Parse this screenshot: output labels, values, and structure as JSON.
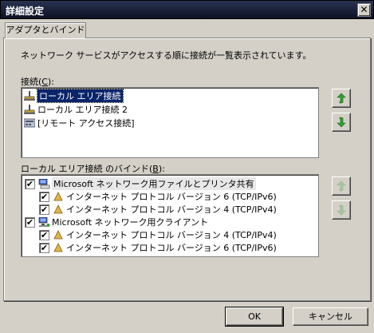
{
  "window": {
    "title": "詳細設定",
    "close_glyph": "✕"
  },
  "tab": {
    "label": "アダプタとバインド"
  },
  "description": "ネットワーク サービスがアクセスする順に接続が一覧表示されています。",
  "connections": {
    "label_prefix": "接続(",
    "label_key": "C",
    "label_suffix": "):",
    "items": [
      {
        "label": "ローカル エリア接続",
        "icon": "network-adapter-icon",
        "selected": true
      },
      {
        "label": "ローカル エリア接続 2",
        "icon": "network-adapter-icon",
        "selected": false
      },
      {
        "label": "[リモート アクセス接続]",
        "icon": "remote-access-icon",
        "selected": false
      }
    ]
  },
  "bindings": {
    "label_prefix": "ローカル エリア接続 のバインド(",
    "label_key": "B",
    "label_suffix": "):",
    "items": [
      {
        "label": "Microsoft ネットワーク用ファイルとプリンタ共有",
        "level": 0,
        "checked": true,
        "icon": "file-printer-sharing-icon"
      },
      {
        "label": "インターネット プロトコル バージョン 6 (TCP/IPv6)",
        "level": 1,
        "checked": true,
        "icon": "protocol-icon"
      },
      {
        "label": "インターネット プロトコル バージョン 4 (TCP/IPv4)",
        "level": 1,
        "checked": true,
        "icon": "protocol-icon"
      },
      {
        "label": "Microsoft ネットワーク用クライアント",
        "level": 0,
        "checked": true,
        "icon": "network-client-icon"
      },
      {
        "label": "インターネット プロトコル バージョン 4 (TCP/IPv4)",
        "level": 1,
        "checked": true,
        "icon": "protocol-icon"
      },
      {
        "label": "インターネット プロトコル バージョン 6 (TCP/IPv6)",
        "level": 1,
        "checked": true,
        "icon": "protocol-icon"
      }
    ]
  },
  "buttons": {
    "ok": "OK",
    "cancel": "キャンセル"
  },
  "colors": {
    "arrow_green": "#2e9e2e",
    "selection": "#0a246a"
  }
}
